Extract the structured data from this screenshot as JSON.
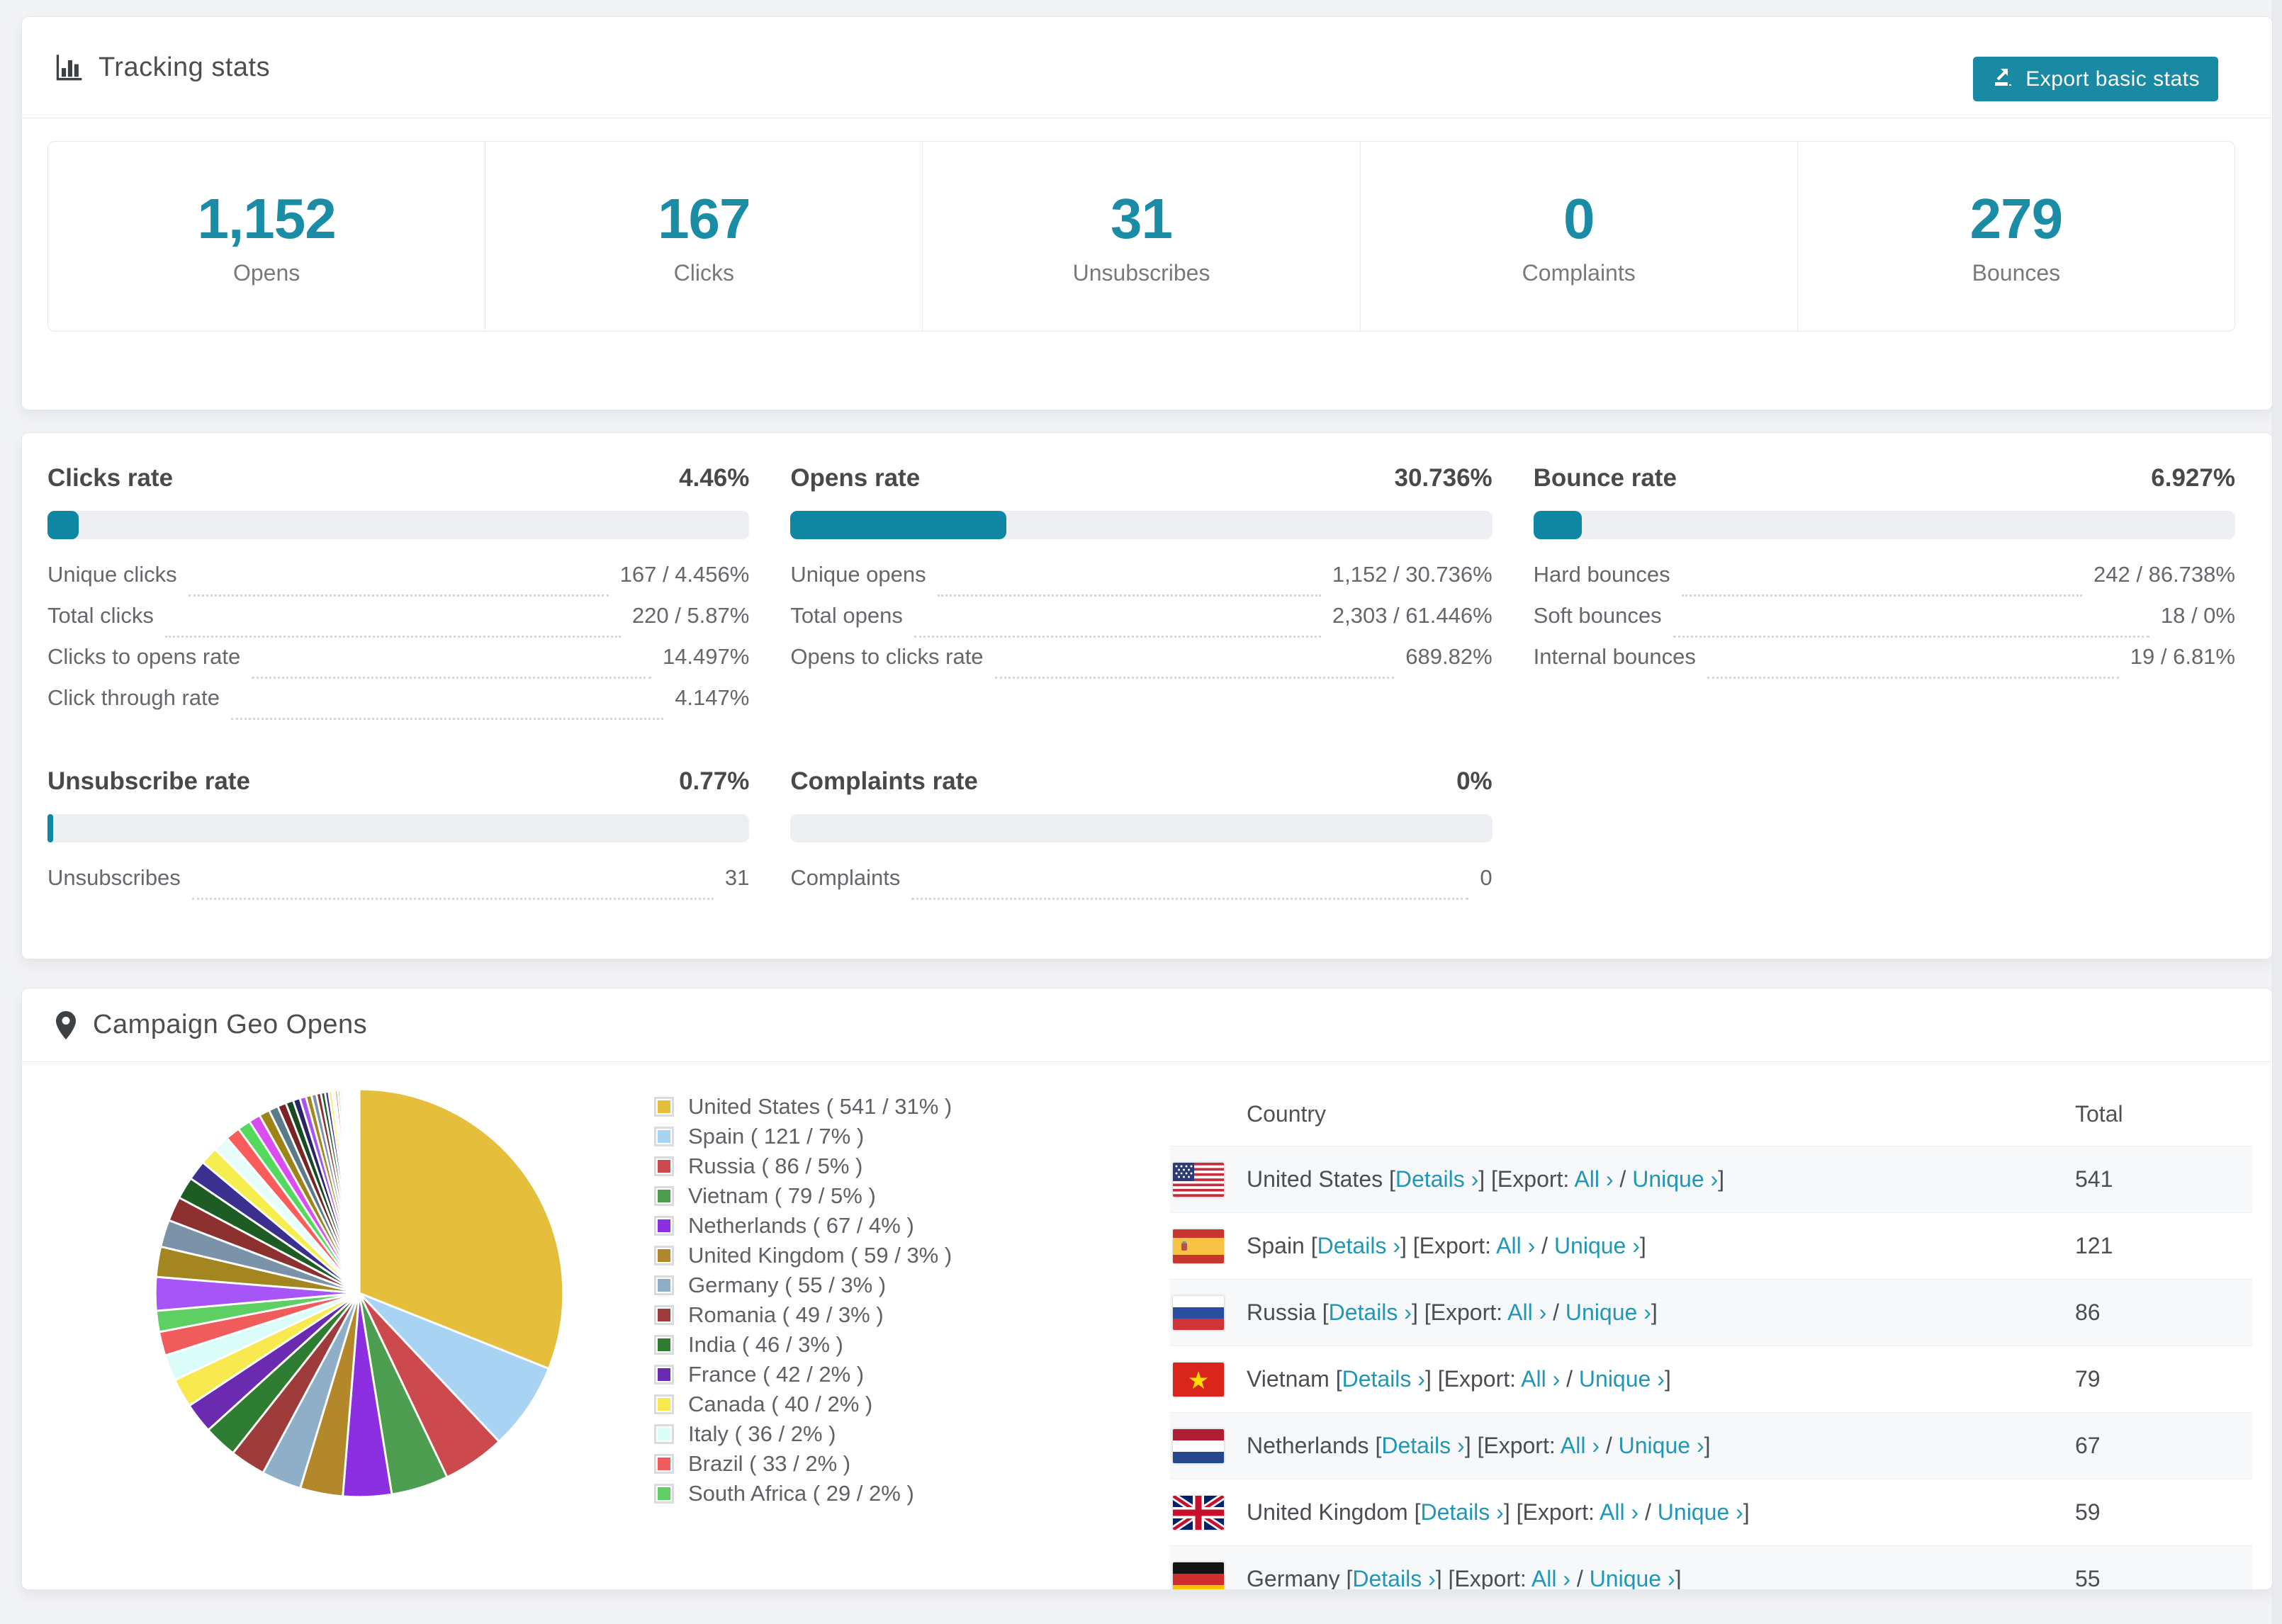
{
  "accent": "#1989a4",
  "link_color": "#2196b5",
  "tracking": {
    "title": "Tracking stats",
    "export_label": "Export basic stats",
    "stats": [
      {
        "value": "1,152",
        "label": "Opens"
      },
      {
        "value": "167",
        "label": "Clicks"
      },
      {
        "value": "31",
        "label": "Unsubscribes"
      },
      {
        "value": "0",
        "label": "Complaints"
      },
      {
        "value": "279",
        "label": "Bounces"
      }
    ]
  },
  "rates": [
    {
      "title": "Clicks rate",
      "value": "4.46%",
      "pct": 4.46,
      "rows": [
        {
          "label": "Unique clicks",
          "value": "167 / 4.456%"
        },
        {
          "label": "Total clicks",
          "value": "220 / 5.87%"
        },
        {
          "label": "Clicks to opens rate",
          "value": "14.497%"
        },
        {
          "label": "Click through rate",
          "value": "4.147%"
        }
      ]
    },
    {
      "title": "Opens rate",
      "value": "30.736%",
      "pct": 30.736,
      "rows": [
        {
          "label": "Unique opens",
          "value": "1,152 / 30.736%"
        },
        {
          "label": "Total opens",
          "value": "2,303 / 61.446%"
        },
        {
          "label": "Opens to clicks rate",
          "value": "689.82%"
        }
      ]
    },
    {
      "title": "Bounce rate",
      "value": "6.927%",
      "pct": 6.927,
      "rows": [
        {
          "label": "Hard bounces",
          "value": "242 / 86.738%"
        },
        {
          "label": "Soft bounces",
          "value": "18 / 0%"
        },
        {
          "label": "Internal bounces",
          "value": "19 / 6.81%"
        }
      ]
    },
    {
      "title": "Unsubscribe rate",
      "value": "0.77%",
      "pct": 0.77,
      "rows": [
        {
          "label": "Unsubscribes",
          "value": "31"
        }
      ]
    },
    {
      "title": "Complaints rate",
      "value": "0%",
      "pct": 0,
      "rows": [
        {
          "label": "Complaints",
          "value": "0"
        }
      ]
    }
  ],
  "geo": {
    "title": "Campaign Geo Opens",
    "table_headers": {
      "country": "Country",
      "total": "Total"
    },
    "links": {
      "open_bracket": " [",
      "details": "Details ›",
      "mid_bracket": "] [",
      "export_prefix": "Export: ",
      "all": "All ›",
      "slash": " / ",
      "unique": "Unique ›",
      "close_bracket": "]"
    },
    "rows": [
      {
        "flag": "us",
        "country": "United States",
        "total": "541"
      },
      {
        "flag": "es",
        "country": "Spain",
        "total": "121"
      },
      {
        "flag": "ru",
        "country": "Russia",
        "total": "86"
      },
      {
        "flag": "vn",
        "country": "Vietnam",
        "total": "79"
      },
      {
        "flag": "nl",
        "country": "Netherlands",
        "total": "67"
      },
      {
        "flag": "gb",
        "country": "United Kingdom",
        "total": "59"
      },
      {
        "flag": "de",
        "country": "Germany",
        "total": "55"
      }
    ]
  },
  "chart_data": {
    "type": "pie",
    "title": "Campaign Geo Opens",
    "legend_position": "right",
    "start_angle_deg": 0,
    "direction": "clockwise",
    "legend_format": "{label} ( {value} / {pct}% )",
    "series": [
      {
        "label": "United States",
        "value": 541,
        "pct": 31,
        "color": "#e5bf3b"
      },
      {
        "label": "Spain",
        "value": 121,
        "pct": 7,
        "color": "#a9d3f2"
      },
      {
        "label": "Russia",
        "value": 86,
        "pct": 5,
        "color": "#cc4a4d"
      },
      {
        "label": "Vietnam",
        "value": 79,
        "pct": 5,
        "color": "#4d9e50"
      },
      {
        "label": "Netherlands",
        "value": 67,
        "pct": 4,
        "color": "#8b2fe0"
      },
      {
        "label": "United Kingdom",
        "value": 59,
        "pct": 3,
        "color": "#b2882a"
      },
      {
        "label": "Germany",
        "value": 55,
        "pct": 3,
        "color": "#8fafc9"
      },
      {
        "label": "Romania",
        "value": 49,
        "pct": 3,
        "color": "#9e3c3c"
      },
      {
        "label": "India",
        "value": 46,
        "pct": 3,
        "color": "#2f7d33"
      },
      {
        "label": "France",
        "value": 42,
        "pct": 2,
        "color": "#6b2bb0"
      },
      {
        "label": "Canada",
        "value": 40,
        "pct": 2,
        "color": "#f8e94e"
      },
      {
        "label": "Italy",
        "value": 36,
        "pct": 2,
        "color": "#dbfdf9"
      },
      {
        "label": "Brazil",
        "value": 33,
        "pct": 2,
        "color": "#f05b5b"
      },
      {
        "label": "South Africa",
        "value": 29,
        "pct": 2,
        "color": "#5ecf63"
      }
    ],
    "unlabeled_remainder": {
      "approx_total": 460,
      "slice_count": 46
    }
  }
}
